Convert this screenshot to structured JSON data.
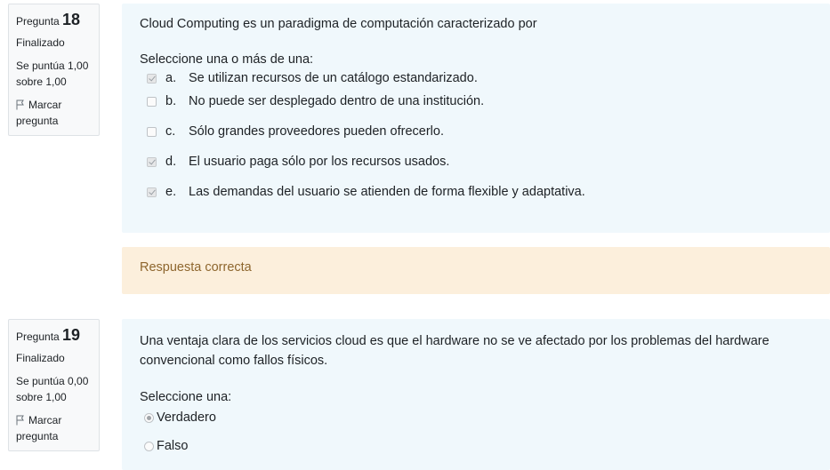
{
  "questions": [
    {
      "label": "Pregunta",
      "number": "18",
      "state": "Finalizado",
      "grade_line1": "Se puntúa 1,00",
      "grade_line2": "sobre 1,00",
      "flag_line1": "Marcar",
      "flag_line2": "pregunta",
      "text": "Cloud Computing es un paradigma de computación caracterizado por",
      "prompt": "Seleccione una o más de una:",
      "answers": [
        {
          "letter": "a.",
          "text": "Se utilizan recursos de un catálogo estandarizado.",
          "checked": true
        },
        {
          "letter": "b.",
          "text": "No puede ser desplegado dentro de una institución.",
          "checked": false
        },
        {
          "letter": "c.",
          "text": "Sólo grandes proveedores pueden ofrecerlo.",
          "checked": false
        },
        {
          "letter": "d.",
          "text": "El usuario paga sólo por los recursos usados.",
          "checked": true
        },
        {
          "letter": "e.",
          "text": "Las demandas del usuario se atienden de forma flexible y adaptativa.",
          "checked": true
        }
      ],
      "feedback": "Respuesta correcta"
    },
    {
      "label": "Pregunta",
      "number": "19",
      "state": "Finalizado",
      "grade_line1": "Se puntúa 0,00",
      "grade_line2": "sobre 1,00",
      "flag_line1": "Marcar",
      "flag_line2": "pregunta",
      "text_line1": "Una ventaja clara de los servicios cloud es que el hardware no se ve afectado por los problemas del hardware",
      "text_line2": "convencional como fallos físicos.",
      "prompt": "Seleccione una:",
      "answers": [
        {
          "text": "Verdadero",
          "checked": true
        },
        {
          "text": "Falso",
          "checked": false
        }
      ]
    }
  ],
  "colors": {
    "info_bg": "#f8f9fa",
    "formulation_bg": "#f0f8fc",
    "outcome_bg": "#fcefdc",
    "outcome_text": "#8e662e"
  },
  "icons": {
    "flag": "flag-icon",
    "checkbox": "checkbox",
    "radio": "radio-button"
  }
}
